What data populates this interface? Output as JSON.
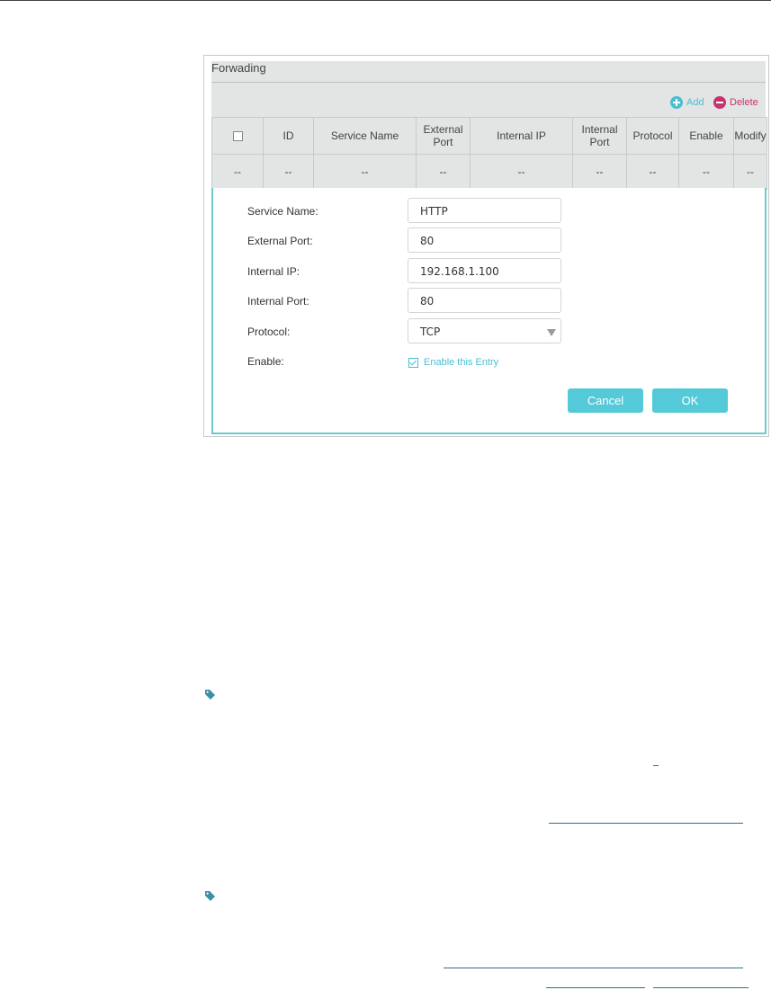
{
  "section": {
    "title": "Forwading"
  },
  "actions": {
    "add_label": "Add",
    "delete_label": "Delete",
    "add_color": "#4bbfd1",
    "delete_color": "#c6336f"
  },
  "table": {
    "columns": [
      "ID",
      "Service Name",
      "External Port",
      "Internal IP",
      "Internal Port",
      "Protocol",
      "Enable",
      "Modify"
    ],
    "row": [
      "--",
      "--",
      "--",
      "--",
      "--",
      "--",
      "--",
      "--",
      "--"
    ]
  },
  "form": {
    "service_name": {
      "label": "Service Name:",
      "value": "HTTP"
    },
    "external_port": {
      "label": "External Port:",
      "value": "80"
    },
    "internal_ip": {
      "label": "Internal IP:",
      "value": "192.168.1.100"
    },
    "internal_port": {
      "label": "Internal Port:",
      "value": "80"
    },
    "protocol": {
      "label": "Protocol:",
      "value": "TCP"
    },
    "enable": {
      "label": "Enable:",
      "checkbox_label": "Enable this Entry",
      "checked": true
    },
    "cancel_label": "Cancel",
    "ok_label": "OK",
    "accent_color": "#54c9d8"
  },
  "icons": {
    "note_icon": "tag-icon"
  }
}
